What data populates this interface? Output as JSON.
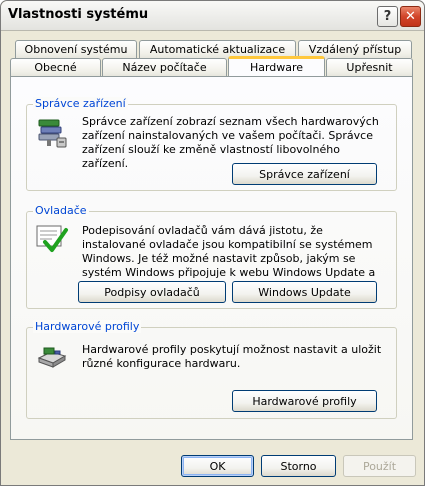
{
  "window": {
    "title": "Vlastnosti systému",
    "help_label": "?",
    "close_label": "✕"
  },
  "tabs": {
    "row1": [
      "Obnovení systému",
      "Automatické aktualizace",
      "Vzdálený přístup"
    ],
    "row2": [
      "Obecné",
      "Název počítače",
      "Hardware",
      "Upřesnit"
    ],
    "active": "Hardware"
  },
  "groups": {
    "device_manager": {
      "label": "Správce zařízení",
      "text": "Správce zařízení zobrazí seznam všech hardwarových zařízení nainstalovaných ve vašem počítači. Správce zařízení slouží ke změně vlastností libovolného zařízení.",
      "button": "Správce zařízení",
      "icon": "device-manager-icon"
    },
    "drivers": {
      "label": "Ovladače",
      "text": "Podepisování ovladačů vám dává jistotu, že instalované ovladače jsou kompatibilní se systémem Windows. Je též možné nastavit způsob, jakým se systém Windows připojuje k webu Windows Update a hledá ovladače.",
      "button_signing": "Podpisy ovladačů",
      "button_update": "Windows Update",
      "icon": "driver-signing-icon"
    },
    "hw_profiles": {
      "label": "Hardwarové profily",
      "text": "Hardwarové profily poskytují možnost nastavit a uložit různé konfigurace hardwaru.",
      "button": "Hardwarové profily",
      "icon": "hardware-profiles-icon"
    }
  },
  "footer": {
    "ok": "OK",
    "cancel": "Storno",
    "apply": "Použít"
  },
  "colors": {
    "accent_tab": "#FFC83C",
    "group_label": "#0046D5",
    "window_bg": "#ECE9D8"
  }
}
